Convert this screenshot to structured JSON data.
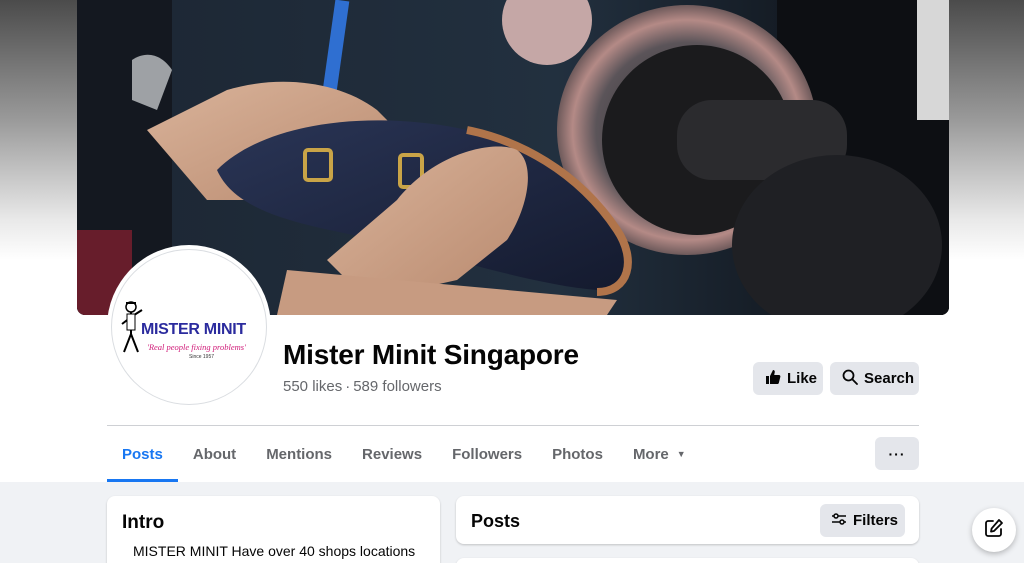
{
  "page": {
    "name": "Mister Minit Singapore",
    "likes": "550 likes",
    "separator": "·",
    "followers": "589 followers"
  },
  "logo": {
    "name": "MISTER MINIT",
    "tagline": "'Real people fixing problems'",
    "since": "Since 1957"
  },
  "actions": {
    "like_label": "Like",
    "search_label": "Search"
  },
  "tabs": [
    {
      "label": "Posts",
      "active": true
    },
    {
      "label": "About"
    },
    {
      "label": "Mentions"
    },
    {
      "label": "Reviews"
    },
    {
      "label": "Followers"
    },
    {
      "label": "Photos"
    },
    {
      "label": "More"
    }
  ],
  "more_menu_label": "···",
  "intro": {
    "title": "Intro",
    "text": "MISTER MINIT Have over 40 shops locations"
  },
  "posts": {
    "title": "Posts",
    "filters_label": "Filters"
  },
  "colors": {
    "accent": "#1877f2",
    "button_bg": "#e4e6eb",
    "page_bg": "#f0f2f5",
    "logo_blue": "#2b2b9e",
    "logo_pink": "#d01a78"
  },
  "icons": {
    "like": "thumbs-up-icon",
    "search": "search-icon",
    "more_tab": "caret-down-icon",
    "more_button": "ellipsis-icon",
    "filters": "sliders-icon",
    "compose": "compose-icon"
  }
}
